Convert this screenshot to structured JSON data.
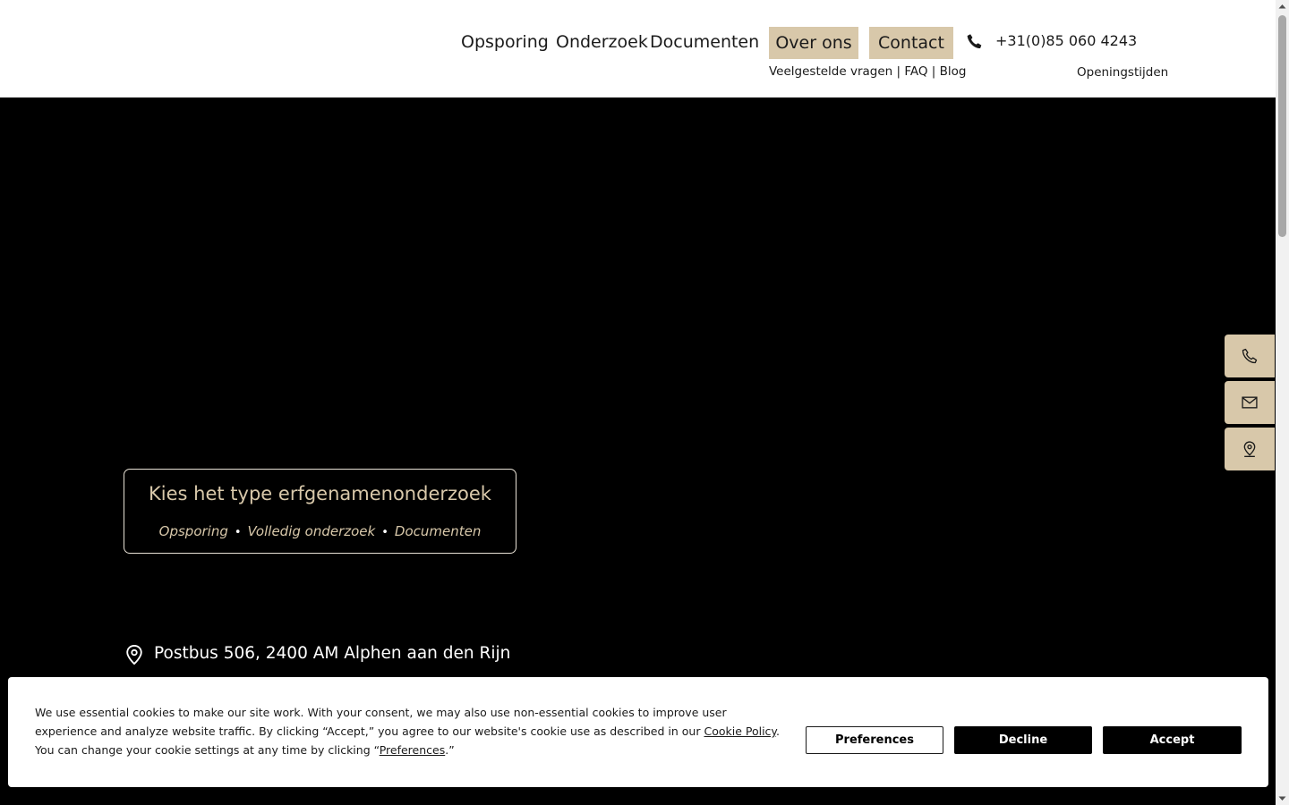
{
  "nav": {
    "items": [
      {
        "label": "Opsporing"
      },
      {
        "label": "Onderzoek"
      },
      {
        "label": "Documenten"
      }
    ],
    "pills": [
      {
        "label": "Over ons"
      },
      {
        "label": "Contact"
      }
    ],
    "phone": "+31(0)85 060 4243",
    "sublinks": {
      "faq_long": "Veelgestelde vragen",
      "sep1": " | ",
      "faq": "FAQ",
      "sep2": " | ",
      "blog": "Blog"
    },
    "openingstijden": "Openingstijden"
  },
  "hero": {
    "choice_title": "Kies het type erfgenamenonderzoek",
    "choice_links": [
      "Opsporing",
      "Volledig onderzoek",
      "Documenten"
    ],
    "separator": "•",
    "address": "Postbus 506, 2400 AM Alphen aan den Rijn"
  },
  "side_buttons": [
    {
      "icon": "phone-icon"
    },
    {
      "icon": "mail-icon"
    },
    {
      "icon": "location-pin-icon"
    }
  ],
  "cookie": {
    "text_before": "We use essential cookies to make our site work. With your consent, we may also use non-essential cookies to improve user experience and analyze website traffic. By clicking “Accept,” you agree to our website's cookie use as described in our ",
    "policy_link": "Cookie Policy",
    "text_middle": ". You can change your cookie settings at any time by clicking “",
    "preferences_link": "Preferences",
    "text_after": ".”",
    "buttons": {
      "preferences": "Preferences",
      "decline": "Decline",
      "accept": "Accept"
    }
  },
  "colors": {
    "accent": "#d8c8aa",
    "background": "#000000",
    "header": "#ffffff"
  }
}
